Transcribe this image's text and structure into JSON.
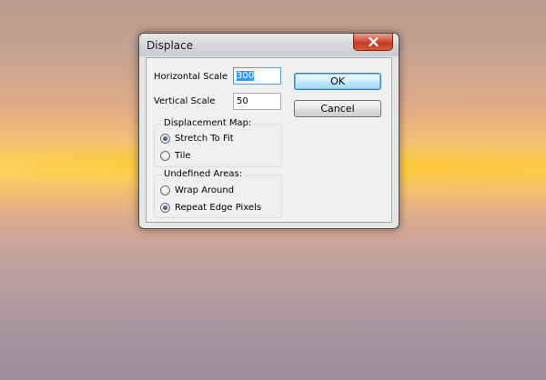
{
  "dialog": {
    "title": "Displace",
    "close_icon": "close-x-icon",
    "horizontal_scale": {
      "label": "Horizontal Scale",
      "value": "300",
      "selected": true
    },
    "vertical_scale": {
      "label": "Vertical Scale",
      "value": "50"
    },
    "displacement_map": {
      "title": "Displacement Map:",
      "options": [
        {
          "label": "Stretch To Fit",
          "checked": true
        },
        {
          "label": "Tile",
          "checked": false
        }
      ]
    },
    "undefined_areas": {
      "title": "Undefined Areas:",
      "options": [
        {
          "label": "Wrap Around",
          "checked": false
        },
        {
          "label": "Repeat Edge Pixels",
          "checked": true
        }
      ]
    },
    "ok_label": "OK",
    "cancel_label": "Cancel"
  },
  "colors": {
    "close_button": "#c2391f",
    "default_button_border": "#3c7fb1",
    "selection": "#3399ff"
  }
}
